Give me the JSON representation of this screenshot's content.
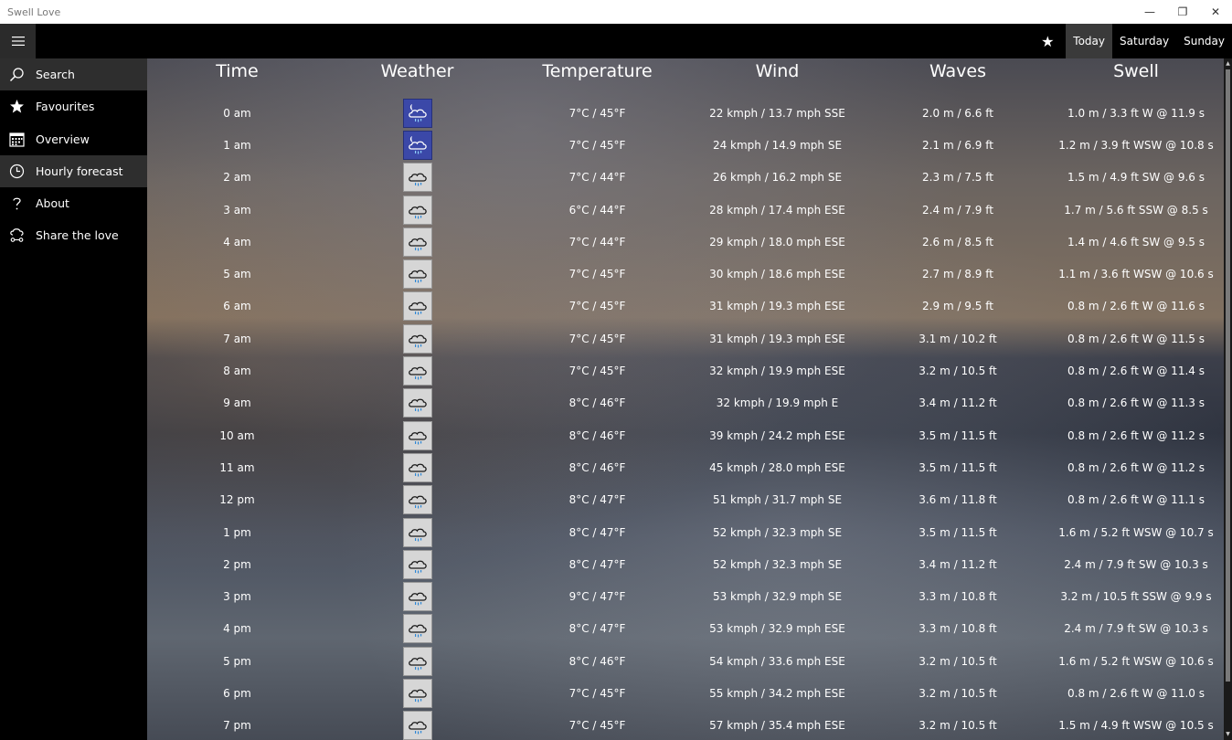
{
  "window": {
    "title": "Swell Love",
    "minimize": "—",
    "restore": "❐",
    "close": "✕"
  },
  "appbar": {
    "favourite_icon": "star-icon",
    "tabs": [
      "Today",
      "Saturday",
      "Sunday"
    ],
    "active_tab": 0
  },
  "sidebar": {
    "items": [
      {
        "label": "Search",
        "icon": "search-icon"
      },
      {
        "label": "Favourites",
        "icon": "star-icon"
      },
      {
        "label": "Overview",
        "icon": "calendar-icon"
      },
      {
        "label": "Hourly forecast",
        "icon": "clock-icon"
      },
      {
        "label": "About",
        "icon": "question-icon"
      },
      {
        "label": "Share the love",
        "icon": "share-icon"
      }
    ],
    "selected": [
      0,
      3
    ]
  },
  "table": {
    "headers": [
      "Time",
      "Weather",
      "Temperature",
      "Wind",
      "Waves",
      "Swell"
    ],
    "rows": [
      {
        "time": "0 am",
        "weather": "night-cloud-rain",
        "temp": "7°C / 45°F",
        "wind": "22 kmph / 13.7 mph SSE",
        "waves": "2.0 m / 6.6 ft",
        "swell": "1.0 m / 3.3 ft W @ 11.9 s"
      },
      {
        "time": "1 am",
        "weather": "night-cloud-rain",
        "temp": "7°C / 45°F",
        "wind": "24 kmph / 14.9 mph SE",
        "waves": "2.1 m / 6.9 ft",
        "swell": "1.2 m / 3.9 ft WSW @ 10.8 s"
      },
      {
        "time": "2 am",
        "weather": "cloud-rain",
        "temp": "7°C / 44°F",
        "wind": "26 kmph / 16.2 mph SE",
        "waves": "2.3 m / 7.5 ft",
        "swell": "1.5 m / 4.9 ft SW @ 9.6 s"
      },
      {
        "time": "3 am",
        "weather": "cloud-rain",
        "temp": "6°C / 44°F",
        "wind": "28 kmph / 17.4 mph ESE",
        "waves": "2.4 m / 7.9 ft",
        "swell": "1.7 m / 5.6 ft SSW @ 8.5 s"
      },
      {
        "time": "4 am",
        "weather": "cloud-rain",
        "temp": "7°C / 44°F",
        "wind": "29 kmph / 18.0 mph ESE",
        "waves": "2.6 m / 8.5 ft",
        "swell": "1.4 m / 4.6 ft SW @ 9.5 s"
      },
      {
        "time": "5 am",
        "weather": "cloud-rain",
        "temp": "7°C / 45°F",
        "wind": "30 kmph / 18.6 mph ESE",
        "waves": "2.7 m / 8.9 ft",
        "swell": "1.1 m / 3.6 ft WSW @ 10.6 s"
      },
      {
        "time": "6 am",
        "weather": "cloud-rain",
        "temp": "7°C / 45°F",
        "wind": "31 kmph / 19.3 mph ESE",
        "waves": "2.9 m / 9.5 ft",
        "swell": "0.8 m / 2.6 ft W @ 11.6 s"
      },
      {
        "time": "7 am",
        "weather": "cloud-rain",
        "temp": "7°C / 45°F",
        "wind": "31 kmph / 19.3 mph ESE",
        "waves": "3.1 m / 10.2 ft",
        "swell": "0.8 m / 2.6 ft W @ 11.5 s"
      },
      {
        "time": "8 am",
        "weather": "cloud-rain",
        "temp": "7°C / 45°F",
        "wind": "32 kmph / 19.9 mph ESE",
        "waves": "3.2 m / 10.5 ft",
        "swell": "0.8 m / 2.6 ft W @ 11.4 s"
      },
      {
        "time": "9 am",
        "weather": "cloud-rain",
        "temp": "8°C / 46°F",
        "wind": "32 kmph / 19.9 mph E",
        "waves": "3.4 m / 11.2 ft",
        "swell": "0.8 m / 2.6 ft W @ 11.3 s"
      },
      {
        "time": "10 am",
        "weather": "cloud-rain",
        "temp": "8°C / 46°F",
        "wind": "39 kmph / 24.2 mph ESE",
        "waves": "3.5 m / 11.5 ft",
        "swell": "0.8 m / 2.6 ft W @ 11.2 s"
      },
      {
        "time": "11 am",
        "weather": "cloud-rain",
        "temp": "8°C / 46°F",
        "wind": "45 kmph / 28.0 mph ESE",
        "waves": "3.5 m / 11.5 ft",
        "swell": "0.8 m / 2.6 ft W @ 11.2 s"
      },
      {
        "time": "12 pm",
        "weather": "cloud-rain",
        "temp": "8°C / 47°F",
        "wind": "51 kmph / 31.7 mph SE",
        "waves": "3.6 m / 11.8 ft",
        "swell": "0.8 m / 2.6 ft W @ 11.1 s"
      },
      {
        "time": "1 pm",
        "weather": "cloud-rain",
        "temp": "8°C / 47°F",
        "wind": "52 kmph / 32.3 mph SE",
        "waves": "3.5 m / 11.5 ft",
        "swell": "1.6 m / 5.2 ft WSW @ 10.7 s"
      },
      {
        "time": "2 pm",
        "weather": "cloud-rain",
        "temp": "8°C / 47°F",
        "wind": "52 kmph / 32.3 mph SE",
        "waves": "3.4 m / 11.2 ft",
        "swell": "2.4 m / 7.9 ft SW @ 10.3 s"
      },
      {
        "time": "3 pm",
        "weather": "cloud-rain",
        "temp": "9°C / 47°F",
        "wind": "53 kmph / 32.9 mph SE",
        "waves": "3.3 m / 10.8 ft",
        "swell": "3.2 m / 10.5 ft SSW @ 9.9 s"
      },
      {
        "time": "4 pm",
        "weather": "cloud-rain",
        "temp": "8°C / 47°F",
        "wind": "53 kmph / 32.9 mph ESE",
        "waves": "3.3 m / 10.8 ft",
        "swell": "2.4 m / 7.9 ft SW @ 10.3 s"
      },
      {
        "time": "5 pm",
        "weather": "cloud-rain",
        "temp": "8°C / 46°F",
        "wind": "54 kmph / 33.6 mph ESE",
        "waves": "3.2 m / 10.5 ft",
        "swell": "1.6 m / 5.2 ft WSW @ 10.6 s"
      },
      {
        "time": "6 pm",
        "weather": "cloud-rain",
        "temp": "7°C / 45°F",
        "wind": "55 kmph / 34.2 mph ESE",
        "waves": "3.2 m / 10.5 ft",
        "swell": "0.8 m / 2.6 ft W @ 11.0 s"
      },
      {
        "time": "7 pm",
        "weather": "cloud-rain",
        "temp": "7°C / 45°F",
        "wind": "57 kmph / 35.4 mph ESE",
        "waves": "3.2 m / 10.5 ft",
        "swell": "1.5 m / 4.9 ft WSW @ 10.5 s"
      }
    ]
  }
}
